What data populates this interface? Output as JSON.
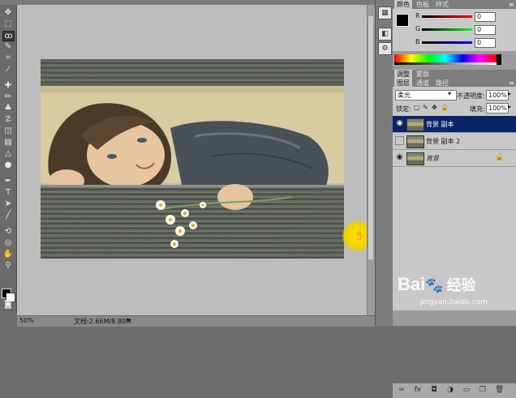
{
  "status": {
    "zoom": "50%",
    "doc_size": "文档:2.66M/8.80M"
  },
  "color_panel": {
    "tabs": [
      "颜色",
      "色板",
      "样式"
    ],
    "r_label": "R",
    "g_label": "G",
    "b_label": "B",
    "r_value": "0",
    "g_value": "0",
    "b_value": "0",
    "fg_color": "#000000",
    "bg_color": "#ffffff"
  },
  "adjust_tabs": [
    "调整",
    "蒙版"
  ],
  "layers_panel": {
    "tabs": [
      "图层",
      "通道",
      "路径"
    ],
    "blend_mode": "柔光",
    "opacity_label": "不透明度:",
    "opacity_value": "100%",
    "lock_label": "锁定:",
    "fill_label": "填充:",
    "fill_value": "100%",
    "layers": [
      {
        "name": "背景 副本",
        "visible": true,
        "selected": true
      },
      {
        "name": "背景 副本 2",
        "visible": false,
        "selected": false
      },
      {
        "name": "背景",
        "visible": true,
        "selected": false,
        "locked": true
      }
    ]
  },
  "watermark": {
    "brand": "Bai",
    "brand2": "经验",
    "site": "jingyan.baidu.com"
  },
  "accent": {
    "selection": "#0a246a",
    "cursor_highlight": "#f4d000"
  }
}
